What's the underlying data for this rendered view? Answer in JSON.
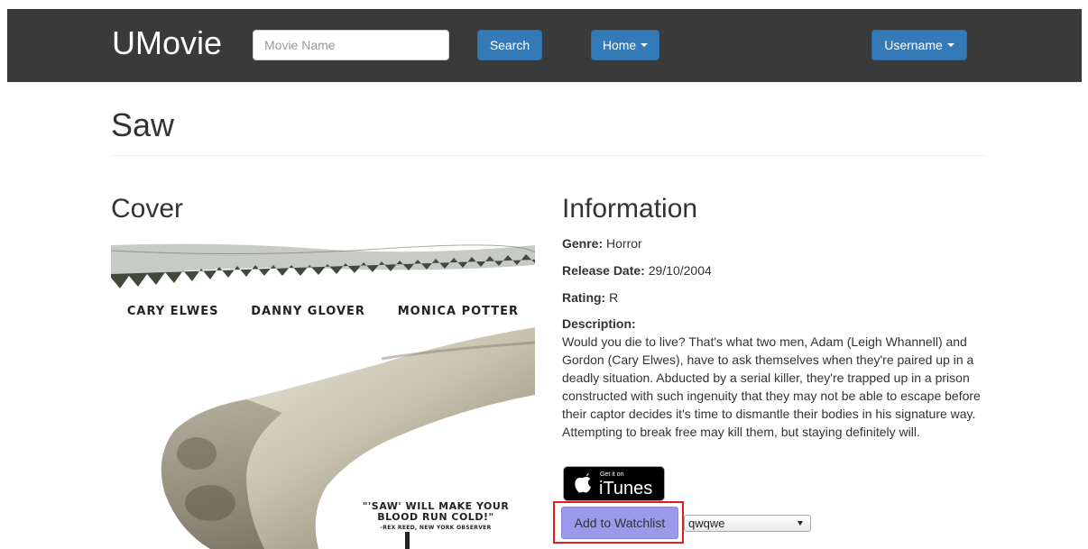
{
  "navbar": {
    "brand": "UMovie",
    "search_placeholder": "Movie Name",
    "search_label": "Search",
    "home_label": "Home",
    "user_label": "Username"
  },
  "page": {
    "title": "Saw"
  },
  "cover": {
    "heading": "Cover",
    "actors": [
      "CARY ELWES",
      "DANNY GLOVER",
      "MONICA POTTER"
    ],
    "quote_line1": "\"'SAW' WILL MAKE YOUR",
    "quote_line2": "BLOOD RUN COLD!\"",
    "quote_attribution": "-REX REED, NEW YORK OBSERVER"
  },
  "information": {
    "heading": "Information",
    "genre_label": "Genre:",
    "genre": "Horror",
    "release_label": "Release Date:",
    "release_date": "29/10/2004",
    "rating_label": "Rating:",
    "rating": "R",
    "description_label": "Description:",
    "description": "Would you die to live? That's what two men, Adam (Leigh Whannell) and Gordon (Cary Elwes), have to ask themselves when they're paired up in a deadly situation. Abducted by a serial killer, they're trapped up in a prison constructed with such ingenuity that they may not be able to escape before their captor decides it's time to dismantle their bodies in his signature way. Attempting to break free may kill them, but staying definitely will."
  },
  "itunes": {
    "small_text": "Get it on",
    "big_text": "iTunes"
  },
  "watchlist": {
    "button_label": "Add to Watchlist",
    "selected_list": "qwqwe"
  },
  "colors": {
    "navbar_bg": "#3a3a3a",
    "primary_button": "#337ab7",
    "watchlist_button": "#9b99e9",
    "highlight_border": "#e02020"
  }
}
